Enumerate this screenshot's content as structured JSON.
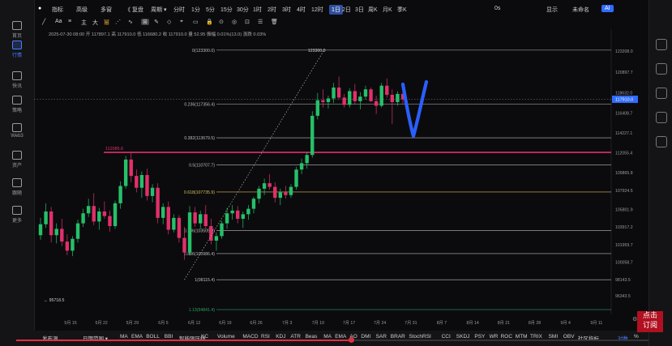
{
  "sidebar": {
    "items": [
      {
        "label": "首页",
        "icon": "home-icon"
      },
      {
        "label": "行情",
        "icon": "chart-icon",
        "active": true
      },
      {
        "label": "快讯",
        "icon": "news-icon"
      },
      {
        "label": "策略",
        "icon": "strategy-icon"
      },
      {
        "label": "Web3",
        "icon": "web3-icon"
      },
      {
        "label": "资产",
        "icon": "asset-icon"
      },
      {
        "label": "跟随",
        "icon": "follow-icon"
      },
      {
        "label": "更多",
        "icon": "more-icon"
      }
    ],
    "version": "VIP"
  },
  "topbar": {
    "items": [
      "指标",
      "高级",
      "多窗",
      "《 复盘",
      "周期 ▾",
      "分时",
      "1分",
      "5分",
      "15分",
      "30分",
      "1时",
      "2时",
      "3时",
      "4时",
      "12时",
      "1日",
      "2日",
      "3日",
      "周K",
      "月K",
      "季K"
    ],
    "active": "1日",
    "right": [
      "0s",
      "显示",
      "未命名",
      "AI",
      ""
    ]
  },
  "toolbar": {
    "tools": [
      "╱",
      "Aa",
      "≡",
      "⋰",
      "∿",
      "⊠",
      "✎",
      "◇",
      "⌖",
      "▭",
      "🔒",
      "⊙",
      "◎",
      "⊡",
      "☰",
      "🗑"
    ],
    "indicators": [
      "主",
      "大",
      "幂"
    ]
  },
  "info": {
    "line1": "2025-07-30 08:00  开 117897.1  高 117910.0  低 116680.2  收 117910.0  量 52.95  振幅 0.01%(13.0)  涨跌 0.03%",
    "line2": ""
  },
  "chart_data": {
    "type": "candlestick",
    "price_axis": [
      "123208.0",
      "120897.7",
      "118632.0",
      "116408.7",
      "114227.1",
      "112055.4",
      "109865.8",
      "107924.5",
      "105801.9",
      "103917.2",
      "101959.7",
      "100058.7",
      "98143.5",
      "96343.5"
    ],
    "current_price": "117910.0",
    "x_labels": [
      "5月 15",
      "5月 22",
      "5月 29",
      "6月 5",
      "6月 12",
      "6月 19",
      "6月 26",
      "7月 3",
      "7月 10",
      "7月 17",
      "7月 24",
      "7月 31",
      "8月 7",
      "8月 14",
      "8月 21",
      "8月 28",
      "9月 4",
      "9月 11"
    ],
    "fib_levels": [
      {
        "ratio": "0",
        "price": "123300.0",
        "label": "0(123300.0)"
      },
      {
        "ratio": "0.236",
        "price": "117356.4",
        "label": "0.236(117356.4)"
      },
      {
        "ratio": "0.382",
        "price": "113679.5",
        "label": "0.382(113679.5)"
      },
      {
        "ratio": "0.5",
        "price": "110707.7",
        "label": "0.5(110707.7)"
      },
      {
        "ratio": "0.618",
        "price": "107735.9",
        "label": "0.618(107735.9)"
      },
      {
        "ratio": "0.786",
        "price": "103505.9",
        "label": "0.786(103505.9)"
      },
      {
        "ratio": "0.886",
        "price": "100986.4",
        "label": "0.886(100986.4)"
      },
      {
        "ratio": "1",
        "price": "98115.4",
        "label": "1(98115.4)"
      },
      {
        "ratio": "1.13",
        "price": "94841.4",
        "label": "1.13(94841.4)"
      }
    ],
    "resistance": {
      "label": "112085.6",
      "price": 112085.6
    },
    "high_label": "123300.0",
    "low_label": "95718.5",
    "annotation": "V",
    "candles": [
      [
        103000,
        104900,
        102500,
        104200
      ],
      [
        104200,
        106500,
        103800,
        105600
      ],
      [
        105600,
        106100,
        102200,
        103000
      ],
      [
        103000,
        104300,
        102100,
        103700
      ],
      [
        103700,
        104800,
        101800,
        102300
      ],
      [
        102300,
        103100,
        100800,
        101300
      ],
      [
        101300,
        102900,
        100700,
        102600
      ],
      [
        102600,
        104700,
        102200,
        104300
      ],
      [
        104300,
        105900,
        103900,
        105400
      ],
      [
        105400,
        107000,
        105000,
        106200
      ],
      [
        106200,
        107600,
        104100,
        104500
      ],
      [
        104500,
        106000,
        103600,
        105600
      ],
      [
        105600,
        106700,
        104800,
        105100
      ],
      [
        105100,
        105700,
        103400,
        104000
      ],
      [
        104000,
        106800,
        103700,
        106500
      ],
      [
        106500,
        108900,
        105900,
        108400
      ],
      [
        108400,
        111700,
        108100,
        111300
      ],
      [
        111300,
        112000,
        108800,
        109500
      ],
      [
        109500,
        110200,
        107700,
        108200
      ],
      [
        108200,
        110000,
        107100,
        109600
      ],
      [
        109600,
        110300,
        106800,
        107300
      ],
      [
        107300,
        108600,
        106600,
        108200
      ],
      [
        108200,
        108700,
        104300,
        104900
      ],
      [
        104900,
        106500,
        104200,
        106100
      ],
      [
        106100,
        106700,
        103100,
        103600
      ],
      [
        103600,
        105300,
        103300,
        104900
      ],
      [
        104900,
        105200,
        102200,
        102700
      ],
      [
        102700,
        103900,
        100300,
        101100
      ],
      [
        101100,
        106200,
        100800,
        105500
      ],
      [
        105500,
        106100,
        103900,
        104300
      ],
      [
        104300,
        105700,
        103700,
        105300
      ],
      [
        105300,
        106300,
        103700,
        104000
      ],
      [
        104000,
        104800,
        102000,
        102400
      ],
      [
        102400,
        103300,
        101300,
        102900
      ],
      [
        102900,
        104600,
        102600,
        104300
      ],
      [
        104300,
        106000,
        103700,
        105400
      ],
      [
        105400,
        106300,
        104700,
        105700
      ],
      [
        105700,
        106200,
        104300,
        104800
      ],
      [
        104800,
        105600,
        103800,
        105300
      ],
      [
        105300,
        106300,
        104700,
        105900
      ],
      [
        105900,
        107200,
        105400,
        107000
      ],
      [
        107000,
        108400,
        106500,
        108100
      ],
      [
        108100,
        109200,
        107400,
        108700
      ],
      [
        108700,
        109700,
        108000,
        108300
      ],
      [
        108300,
        108800,
        106600,
        107100
      ],
      [
        107100,
        108100,
        106300,
        107700
      ],
      [
        107700,
        108400,
        107000,
        107400
      ],
      [
        107400,
        108600,
        107100,
        108300
      ],
      [
        108300,
        110500,
        108000,
        110200
      ],
      [
        110200,
        111400,
        109700,
        110900
      ],
      [
        110900,
        112100,
        110300,
        111800
      ],
      [
        111800,
        116600,
        111500,
        116100
      ],
      [
        116100,
        118600,
        115700,
        117800
      ],
      [
        117800,
        119000,
        117000,
        117600
      ],
      [
        117600,
        118300,
        116900,
        118000
      ],
      [
        118000,
        119700,
        117500,
        119200
      ],
      [
        119200,
        120400,
        117900,
        118100
      ],
      [
        118100,
        118500,
        117000,
        117300
      ],
      [
        117300,
        119100,
        117000,
        118800
      ],
      [
        118800,
        119600,
        117400,
        117700
      ],
      [
        117700,
        118700,
        116800,
        118200
      ],
      [
        118200,
        119400,
        117900,
        119000
      ],
      [
        119000,
        119200,
        117600,
        117700
      ],
      [
        117700,
        118300,
        116300,
        117200
      ],
      [
        117200,
        119700,
        117000,
        119400
      ],
      [
        119400,
        120200,
        118100,
        118400
      ],
      [
        118400,
        119000,
        115200,
        117600
      ],
      [
        117600,
        118800,
        117200,
        118500
      ],
      [
        118500,
        119100,
        117400,
        117900
      ]
    ]
  },
  "bottombar": {
    "left": [
      "发布测",
      "日期范围 ▾"
    ],
    "indicators": [
      "MA",
      "EMA",
      "BOLL",
      "BBI",
      "智能限压线",
      "KC",
      "Volume",
      "MACD",
      "RSI",
      "KDJ",
      "ATR",
      "Beas",
      "MA",
      "EMA",
      "AO",
      "DMI",
      "SAR",
      "BRAR",
      "StochRSI",
      "CCI",
      "SKDJ",
      "PSY",
      "WR",
      "ROC",
      "MTM",
      "TRIX",
      "SMI",
      "OBV",
      "社区指标"
    ],
    "right": [
      "对数",
      "%"
    ],
    "progress": 0.53
  },
  "stamp": {
    "line1": "点击",
    "line2": "订阅"
  },
  "colors": {
    "up": "#26c06a",
    "down": "#e0306a",
    "resistance": "#e0306a",
    "fib": "#cfcfcf",
    "annotation": "#2a5fff",
    "accent": "#2f4f9e"
  }
}
